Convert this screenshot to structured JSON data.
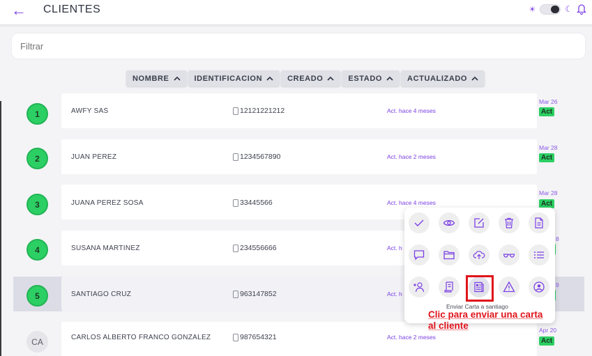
{
  "header": {
    "back_icon": "arrow-left-icon",
    "title": "CLIENTES",
    "accent": "#7b3fe4"
  },
  "filter": {
    "placeholder": "Filtrar"
  },
  "sort": [
    "NOMBRE",
    "IDENTIFICACION",
    "CREADO",
    "ESTADO",
    "ACTUALIZADO"
  ],
  "rows": [
    {
      "index": "1",
      "name": "AWFY SAS",
      "ident": "12121221212",
      "updated": "Act. hace 4 meses",
      "date": "Mar 26",
      "status": "Act"
    },
    {
      "index": "2",
      "name": "JUAN PEREZ",
      "ident": "1234567890",
      "updated": "Act. hace 2 meses",
      "date": "Mar 28",
      "status": "Act"
    },
    {
      "index": "3",
      "name": "JUANA PEREZ SOSA",
      "ident": "33445566",
      "updated": "Act. hace 4 meses",
      "date": "Mar 28",
      "status": "Act"
    },
    {
      "index": "4",
      "name": "SUSANA MARTINEZ",
      "ident": "234556666",
      "updated": "Act. h",
      "date": "8",
      "status": ""
    },
    {
      "index": "5",
      "name": "SANTIAGO CRUZ",
      "ident": "963147852",
      "updated": "Act. h",
      "date": "9",
      "status": ""
    },
    {
      "index": "CA",
      "name": "CARLOS ALBERTO FRANCO GONZALEZ",
      "ident": "987654321",
      "updated": "Act. hace 2 meses",
      "date": "Apr 20",
      "status": "Act"
    }
  ],
  "actions": {
    "icons": [
      "check-icon",
      "eye-icon",
      "edit-icon",
      "trash-icon",
      "document-icon",
      "chat-icon",
      "folder-icon",
      "cloud-upload-icon",
      "glasses-icon",
      "list-icon",
      "add-user-icon",
      "receipt-icon",
      "newspaper-icon",
      "warning-icon",
      "user-circle-icon"
    ],
    "tooltip": "Enviar Carta a santiago"
  },
  "annotation": {
    "text_line1": "Clic para enviar una carta",
    "text_line2": "al cliente",
    "color": "#e0141b"
  }
}
